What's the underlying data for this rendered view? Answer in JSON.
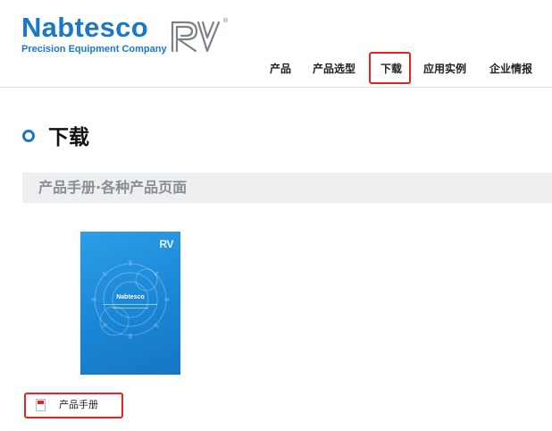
{
  "header": {
    "brand": "Nabtesco",
    "tagline": "Precision Equipment Company",
    "product_logo": "RV"
  },
  "nav": {
    "items": [
      {
        "label": "产品"
      },
      {
        "label": "产品选型"
      },
      {
        "label": "下载"
      },
      {
        "label": "应用实例"
      },
      {
        "label": "企业情报"
      }
    ],
    "active_index": 2
  },
  "page": {
    "title": "下载"
  },
  "section": {
    "title": "产品手册·各种产品页面"
  },
  "brochure": {
    "cover_logo": "RV",
    "cover_brand": "Nabtesco",
    "link_label": "产品手册",
    "file_icon": "pdf-file-icon"
  },
  "colors": {
    "brand_blue": "#1a78c8",
    "highlight_red": "#e8231f",
    "section_bg": "#eeeff1",
    "section_text": "#8a8d92"
  }
}
